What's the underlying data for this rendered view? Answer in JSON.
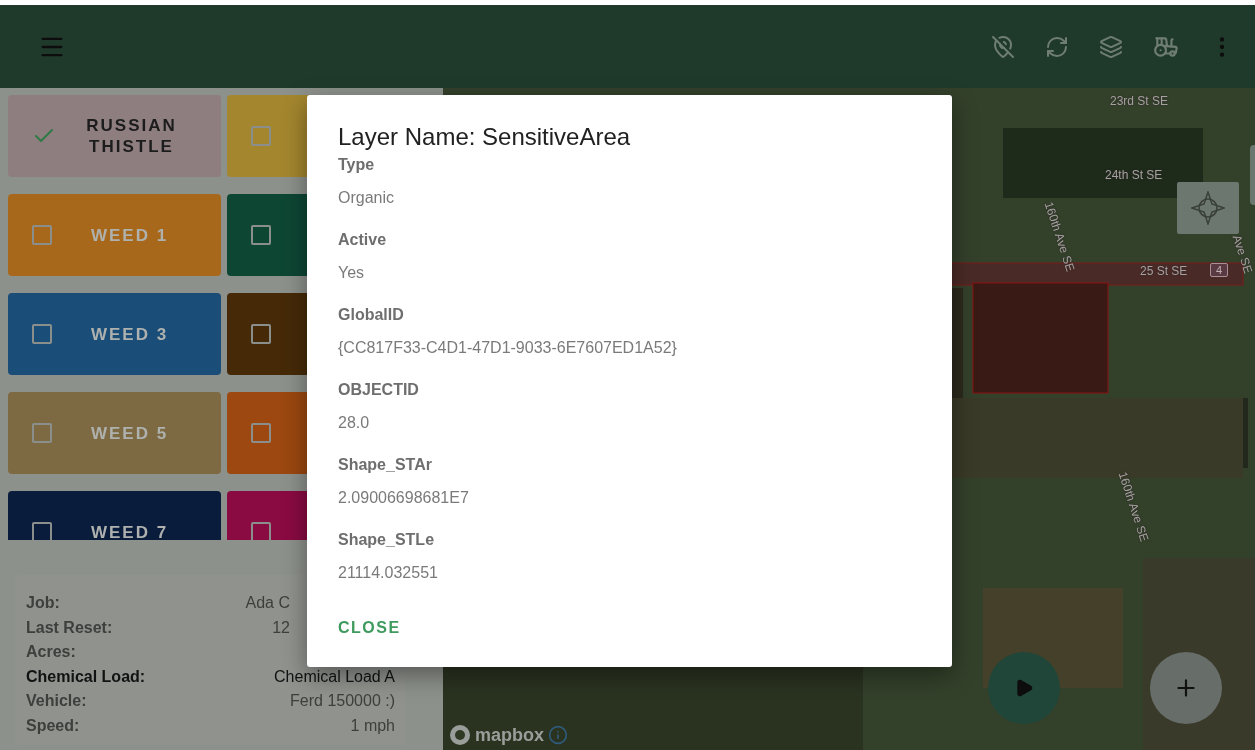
{
  "weed_buttons": [
    {
      "label": "RUSSIAN THISTLE",
      "checked": true,
      "color": "#8e7e80"
    },
    {
      "checked": false,
      "color": "#a4862e"
    },
    {
      "label": "WEED 1",
      "checked": false,
      "color": "#a8681c"
    },
    {
      "checked": false,
      "color": "#0e4634"
    },
    {
      "label": "WEED 3",
      "checked": false,
      "color": "#1a4d78"
    },
    {
      "checked": false,
      "color": "#462a08"
    },
    {
      "label": "WEED 5",
      "checked": false,
      "color": "#7e6a42"
    },
    {
      "checked": false,
      "color": "#9c4810"
    },
    {
      "label": "WEED 7",
      "checked": false,
      "color": "#0a1c3c"
    },
    {
      "checked": false,
      "color": "#8a0a42"
    }
  ],
  "info_panel": {
    "rows": [
      {
        "label": "Job:",
        "value": "Ada C",
        "bold": false
      },
      {
        "label": "Last Reset:",
        "value": "12",
        "bold": false
      },
      {
        "label": "Acres:",
        "bold": false
      },
      {
        "label": "Chemical Load:",
        "value": "Chemical Load A",
        "bold": true
      },
      {
        "label": "Vehicle:",
        "value": "Ferd 150000 :)",
        "bold": false
      },
      {
        "label": "Speed:",
        "value": "1 mph",
        "bold": false
      }
    ]
  },
  "map": {
    "road_labels": [
      "23rd St SE",
      "24th St SE",
      "160th Ave SE",
      "25 St SE",
      "4",
      "Ave SE",
      "160th Ave SE"
    ],
    "attribution": "mapbox"
  },
  "dialog": {
    "title": "Layer Name: SensitiveArea",
    "fields": [
      {
        "label": "Type",
        "value": "Organic"
      },
      {
        "label": "Active",
        "value": "Yes"
      },
      {
        "label": "GlobalID",
        "value": "{CC817F33-C4D1-47D1-9033-6E7607ED1A52}"
      },
      {
        "label": "OBJECTID",
        "value": "28.0"
      },
      {
        "label": "Shape_STAr",
        "value": "2.09006698681E7"
      },
      {
        "label": "Shape_STLe",
        "value": "21114.032551"
      }
    ],
    "close_label": "CLOSE"
  }
}
